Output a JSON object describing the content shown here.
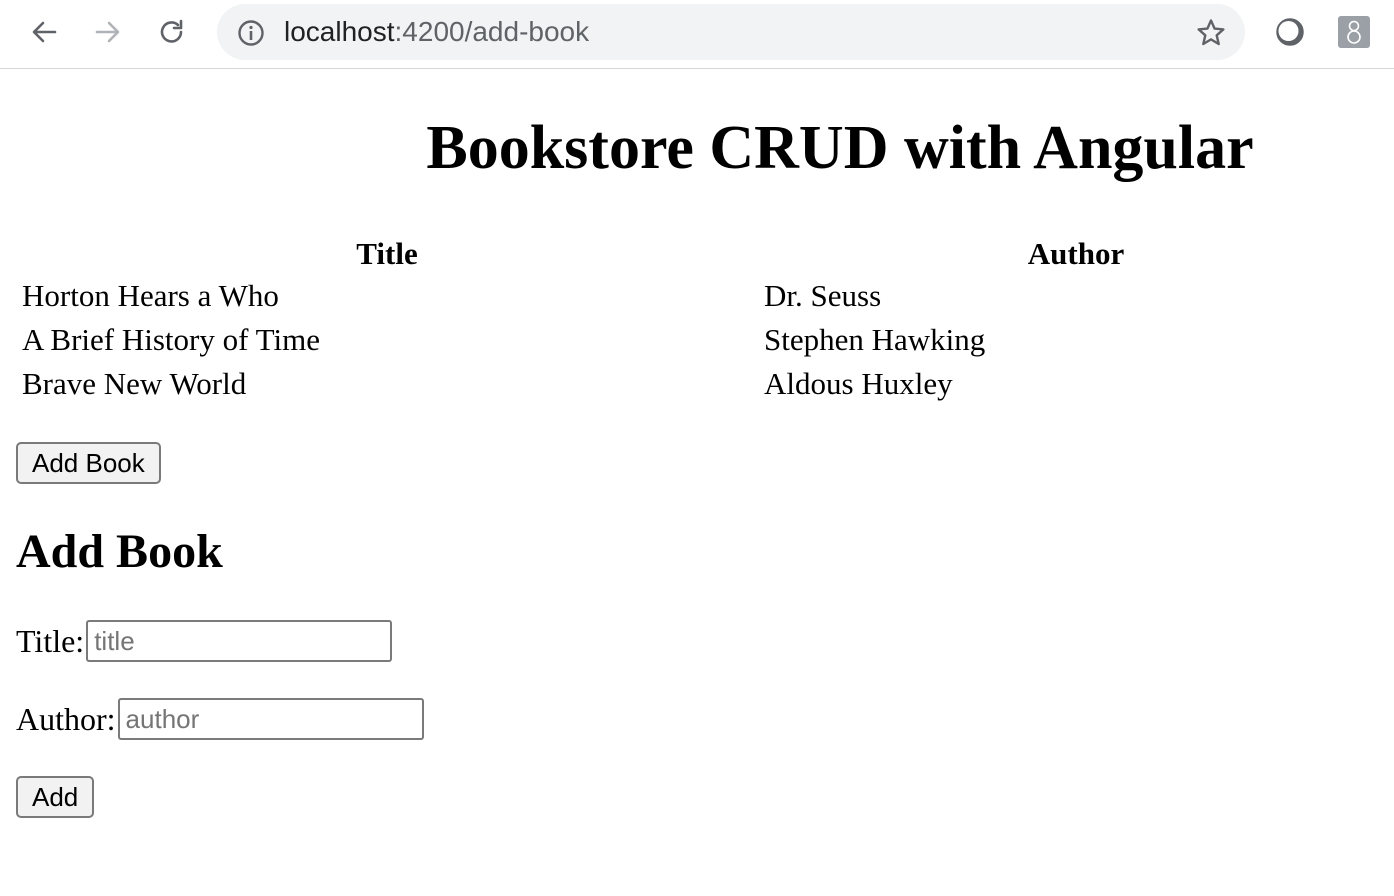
{
  "browser": {
    "url_host": "localhost",
    "url_path": ":4200/add-book"
  },
  "header": {
    "title": "Bookstore CRUD with Angular"
  },
  "table": {
    "columns": [
      "Title",
      "Author"
    ],
    "rows": [
      {
        "title": "Horton Hears a Who",
        "author": "Dr. Seuss"
      },
      {
        "title": "A Brief History of Time",
        "author": "Stephen Hawking"
      },
      {
        "title": "Brave New World",
        "author": "Aldous Huxley"
      }
    ]
  },
  "actions": {
    "add_book_label": "Add Book"
  },
  "form": {
    "heading": "Add Book",
    "title_label": "Title:",
    "title_placeholder": "title",
    "title_value": "",
    "author_label": "Author:",
    "author_placeholder": "author",
    "author_value": "",
    "submit_label": "Add"
  }
}
